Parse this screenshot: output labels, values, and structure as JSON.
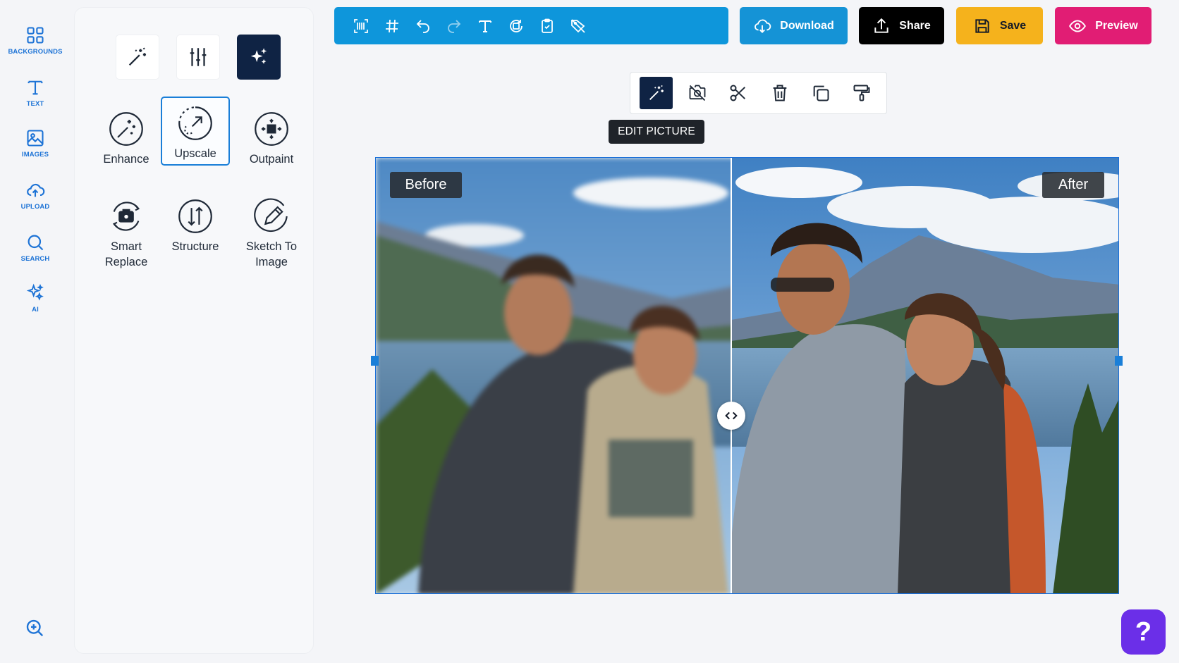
{
  "rail": {
    "items": [
      {
        "label": "BACKGROUNDS",
        "icon": "grid-icon"
      },
      {
        "label": "TEXT",
        "icon": "text-icon"
      },
      {
        "label": "IMAGES",
        "icon": "image-icon"
      },
      {
        "label": "UPLOAD",
        "icon": "cloud-upload-icon"
      },
      {
        "label": "SEARCH",
        "icon": "search-icon"
      },
      {
        "label": "AI",
        "icon": "ai-sparkles-icon"
      }
    ],
    "zoom_icon": "zoom-in-icon"
  },
  "panel": {
    "modes": [
      {
        "icon": "magic-wand-icon",
        "active": false
      },
      {
        "icon": "sliders-icon",
        "active": false
      },
      {
        "icon": "sparkles-icon",
        "active": true
      }
    ],
    "tools": [
      {
        "label": "Enhance",
        "icon": "enhance-icon",
        "selected": false
      },
      {
        "label": "Upscale",
        "icon": "upscale-icon",
        "selected": true
      },
      {
        "label": "Outpaint",
        "icon": "outpaint-icon",
        "selected": false
      },
      {
        "label": "Smart Replace",
        "icon": "smart-replace-icon",
        "selected": false
      },
      {
        "label": "Structure",
        "icon": "structure-icon",
        "selected": false
      },
      {
        "label": "Sketch To Image",
        "icon": "sketch-icon",
        "selected": false
      }
    ]
  },
  "toolbar": {
    "icons": [
      "qr-code-icon",
      "grid-hash-icon",
      "undo-icon",
      "redo-icon",
      "text-icon",
      "rotate-icon",
      "clipboard-icon",
      "no-tag-icon"
    ],
    "download_label": "Download",
    "share_label": "Share",
    "save_label": "Save",
    "preview_label": "Preview",
    "colors": {
      "bar": "#0e96db",
      "download": "#1593d6",
      "share": "#000000",
      "save": "#f5b21c",
      "preview": "#e11d74"
    }
  },
  "image_toolbar": {
    "icons": [
      "magic-wand-icon",
      "no-camera-icon",
      "scissors-icon",
      "trash-icon",
      "duplicate-icon",
      "paint-roller-icon"
    ],
    "tooltip": "EDIT PICTURE"
  },
  "canvas": {
    "before_label": "Before",
    "after_label": "After"
  },
  "help": {
    "label": "?"
  }
}
